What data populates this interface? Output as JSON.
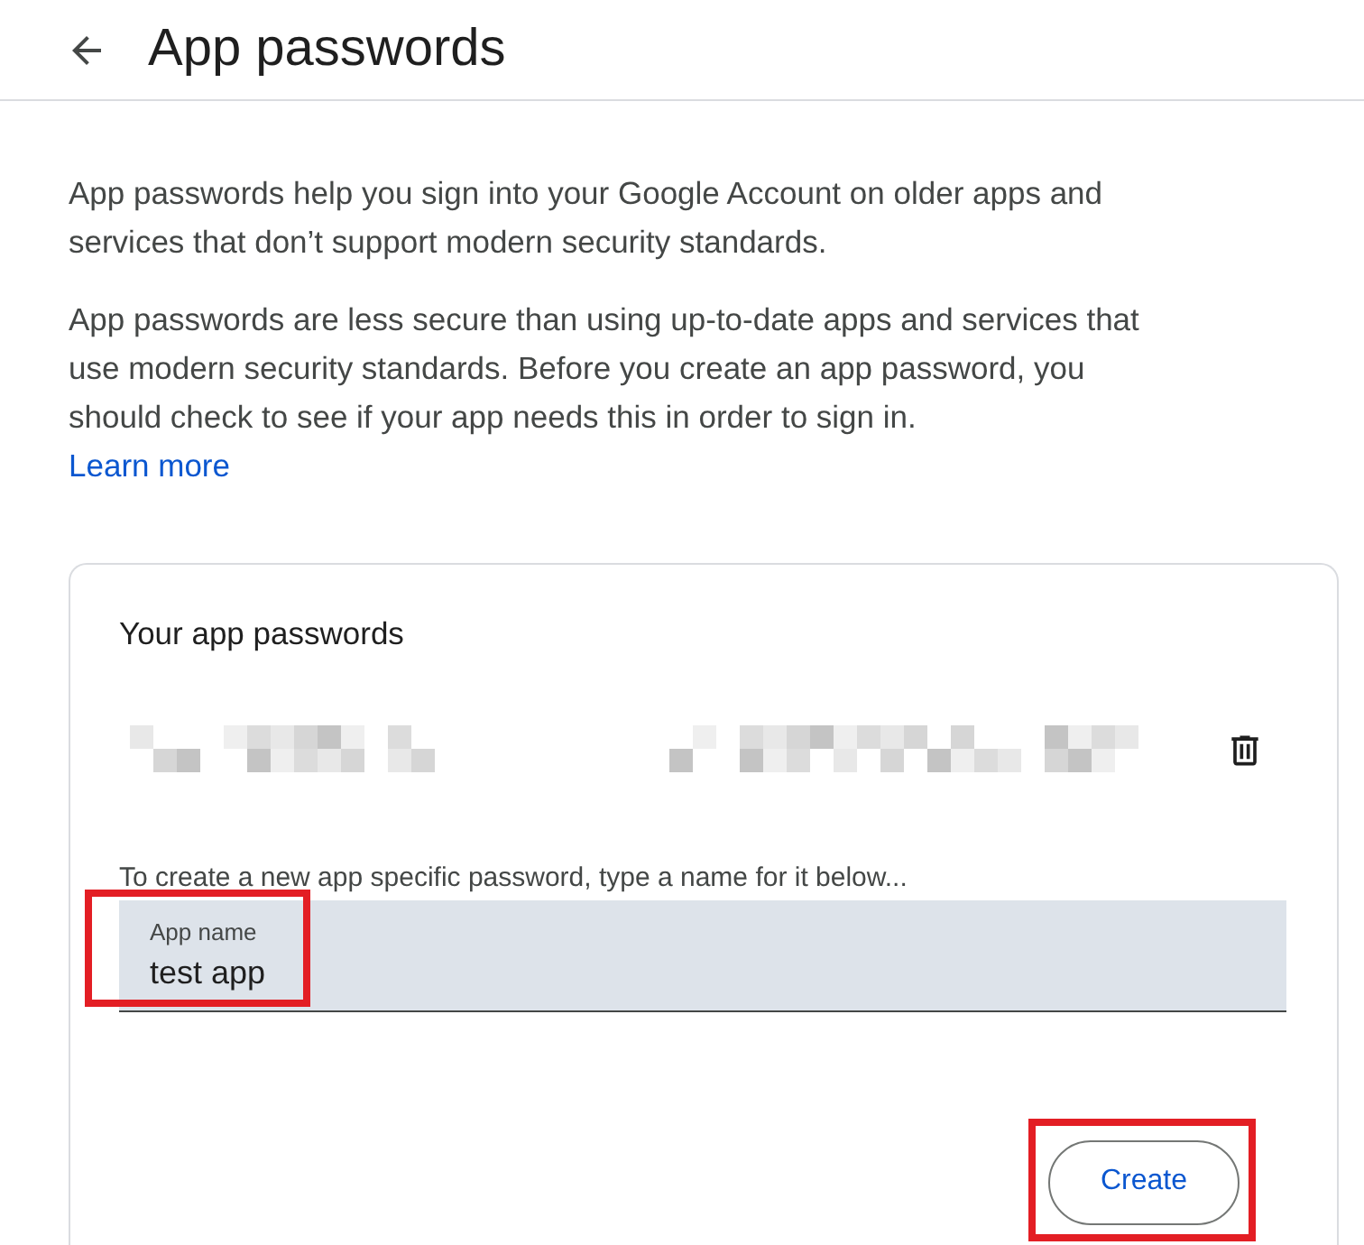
{
  "header": {
    "title": "App passwords"
  },
  "intro": [
    "App passwords help you sign into your Google Account on older apps and services that don’t support modern security standards.",
    "App passwords are less secure than using up-to-date apps and services that use modern security standards. Before you create an app password, you should check to see if your app needs this in order to sign in."
  ],
  "learn_more": "Learn more",
  "card": {
    "title": "Your app passwords",
    "hint": "To create a new app specific password, type a name for it below...",
    "field": {
      "label": "App name",
      "value": "test app",
      "highlighted": true
    },
    "create_button": {
      "label": "Create",
      "highlighted": true
    }
  }
}
